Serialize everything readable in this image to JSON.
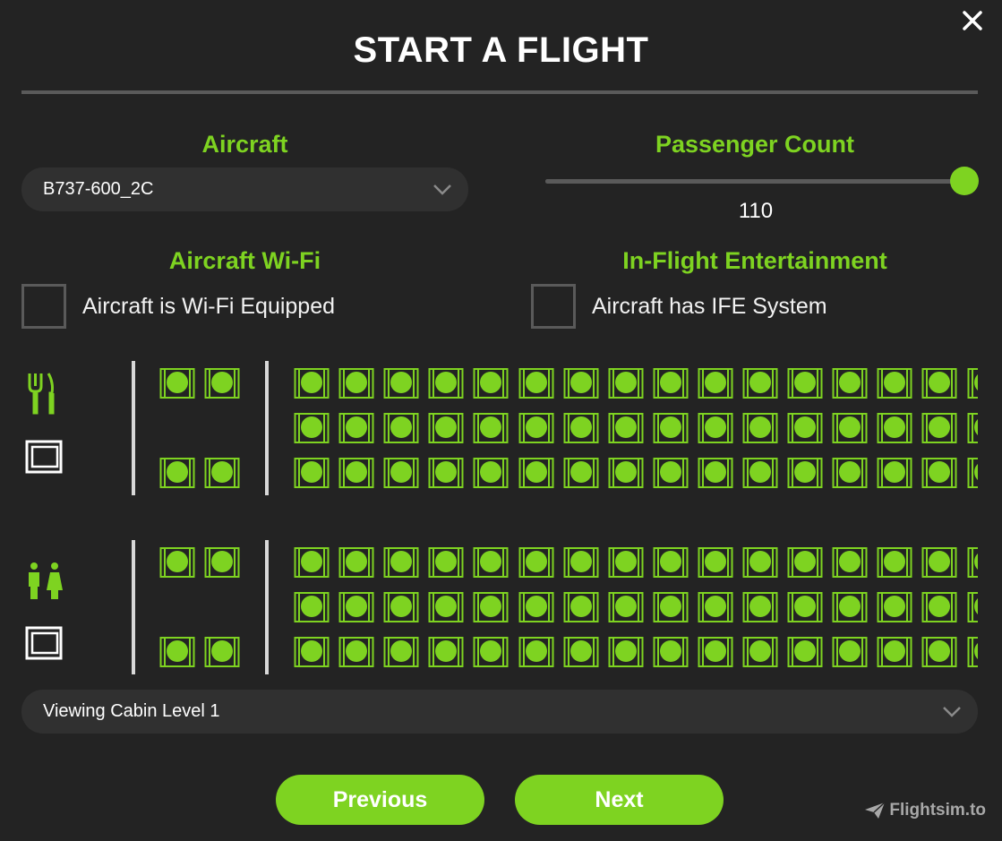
{
  "title": "START A FLIGHT",
  "aircraft": {
    "label": "Aircraft",
    "selected": "B737-600_2C"
  },
  "passenger_count": {
    "label": "Passenger Count",
    "value": "110",
    "fraction": 1.0
  },
  "wifi": {
    "label": "Aircraft Wi-Fi",
    "checkbox_label": "Aircraft is Wi-Fi Equipped",
    "checked": false
  },
  "ife": {
    "label": "In-Flight Entertainment",
    "checkbox_label": "Aircraft has IFE System",
    "checked": false
  },
  "cabin": {
    "first_class_seats_per_row": 2,
    "economy_columns_visible": 16,
    "seat_occupied_color": "#7ed321",
    "rows": [
      {
        "icon": "dining-icon",
        "galley_icon": "galley-icon"
      },
      {
        "icon": "lavatory-icon",
        "galley_icon": "galley-icon"
      }
    ]
  },
  "cabin_level": {
    "selected": "Viewing Cabin Level 1"
  },
  "buttons": {
    "previous": "Previous",
    "next": "Next"
  },
  "watermark": "Flightsim.to",
  "colors": {
    "accent": "#7ed321",
    "background": "#232323",
    "control": "#303030"
  }
}
